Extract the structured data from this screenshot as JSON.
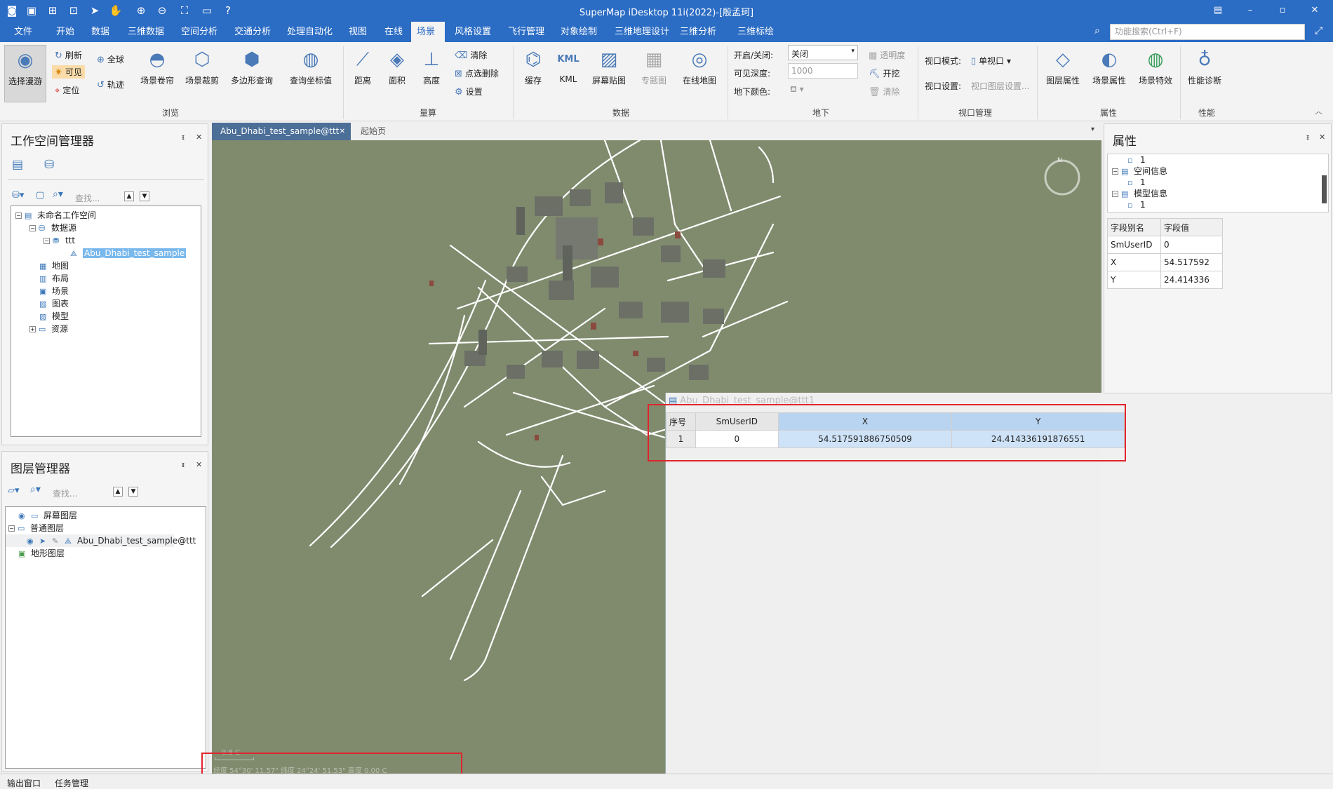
{
  "window": {
    "title": "SuperMap iDesktop 11i(2022)-[殷孟珂]"
  },
  "menu": [
    "文件",
    "开始",
    "数据",
    "三维数据",
    "空间分析",
    "交通分析",
    "处理自动化",
    "视图",
    "在线",
    "场景",
    "风格设置",
    "飞行管理",
    "对象绘制",
    "三维地理设计",
    "三维分析",
    "三维标绘"
  ],
  "menu_active": "场景",
  "search": {
    "placeholder": "功能搜索(Ctrl+F)"
  },
  "ribbon": {
    "browse": {
      "select": "选择漫游",
      "refresh": "刷新",
      "visible": "可见",
      "locate": "定位",
      "globe": "全球",
      "track": "轨迹",
      "roll": "场景卷帘",
      "clip": "场景裁剪",
      "poly": "多边形查询",
      "coord": "查询坐标值",
      "label": "浏览"
    },
    "measure": {
      "dist": "距离",
      "area": "面积",
      "height": "高度",
      "clear": "清除",
      "pick_delete": "点选删除",
      "settings": "设置",
      "label": "量算"
    },
    "data": {
      "cache": "缓存",
      "kml": "KML",
      "screen": "屏幕贴图",
      "thematic": "专题图",
      "online": "在线地图",
      "label": "数据"
    },
    "underground": {
      "onoff_label": "开启/关闭:",
      "onoff_value": "关闭",
      "depth_label": "可见深度:",
      "depth_value": "1000",
      "color_label": "地下颜色:",
      "transparency": "透明度",
      "excavate": "开挖",
      "clear": "清除",
      "label": "地下"
    },
    "viewport": {
      "mode_label": "视口模式:",
      "mode_value": "单视口",
      "settings_label": "视口设置:",
      "settings_value": "视口图层设置...",
      "label": "视口管理"
    },
    "props": {
      "layer": "图层属性",
      "scene": "场景属性",
      "effects": "场景特效",
      "label": "属性"
    },
    "perf": {
      "diag": "性能诊断",
      "label": "性能"
    }
  },
  "workspace": {
    "title": "工作空间管理器",
    "search": "查找...",
    "tree": {
      "root": "未命名工作空间",
      "datasource": "数据源",
      "ds": "ttt",
      "dataset": "Abu_Dhabi_test_sample",
      "maps": "地图",
      "layouts": "布局",
      "scenes": "场景",
      "charts": "图表",
      "models": "模型",
      "resources": "资源"
    }
  },
  "layers": {
    "title": "图层管理器",
    "search": "查找...",
    "screen": "屏幕图层",
    "normal": "普通图层",
    "layer": "Abu_Dhabi_test_sample@ttt",
    "terrain": "地形图层"
  },
  "tabs": {
    "active": "Abu_Dhabi_test_sample@ttt",
    "start": "起始页"
  },
  "scene_overlay": {
    "compass": "N",
    "scale": "0.8 C",
    "status": "经度 54°30' 11.57\"   纬度 24°24' 51.53\"   高度 0.00 C"
  },
  "attr_window": {
    "title": "Abu_Dhabi_test_sample@ttt1",
    "headers": [
      "序号",
      "SmUserID",
      "X",
      "Y"
    ],
    "rows": [
      [
        "1",
        "0",
        "54.517591886750509",
        "24.414336191876551"
      ]
    ]
  },
  "properties": {
    "title": "属性",
    "tree": [
      "1",
      "空间信息",
      "1",
      "模型信息",
      "1"
    ],
    "headers": [
      "字段别名",
      "字段值"
    ],
    "rows": [
      [
        "SmUserID",
        "0"
      ],
      [
        "X",
        "54.517592"
      ],
      [
        "Y",
        "24.414336"
      ]
    ]
  },
  "statusbar": {
    "output": "输出窗口",
    "tasks": "任务管理"
  }
}
